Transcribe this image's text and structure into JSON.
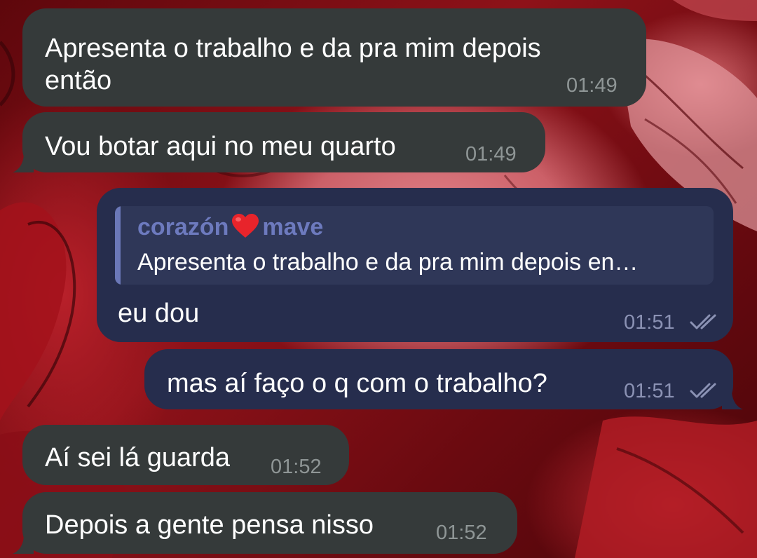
{
  "messages": [
    {
      "direction": "incoming",
      "line1": "Apresenta o trabalho e da pra mim depois",
      "line2": "então",
      "time": "01:49"
    },
    {
      "direction": "incoming",
      "text": "Vou botar aqui no meu quarto",
      "time": "01:49"
    },
    {
      "direction": "outgoing",
      "reply": {
        "sender_part1": "corazón",
        "sender_emoji": "red-heart-emoji",
        "sender_part2": "mave",
        "quoted_text": "Apresenta o trabalho e da pra mim depois en…"
      },
      "text": "eu dou",
      "time": "01:51",
      "status": "read"
    },
    {
      "direction": "outgoing",
      "text": "mas aí faço o q com o trabalho?",
      "time": "01:51",
      "status": "read"
    },
    {
      "direction": "incoming",
      "text": "Aí sei lá guarda",
      "time": "01:52"
    },
    {
      "direction": "incoming",
      "text": "Depois a gente pensa nisso",
      "time": "01:52"
    }
  ],
  "colors": {
    "incoming_bubble": "#353a3a",
    "outgoing_bubble": "#262d4d",
    "reply_accent": "#6d7abe",
    "wallpaper_base": "#7a0d12"
  }
}
